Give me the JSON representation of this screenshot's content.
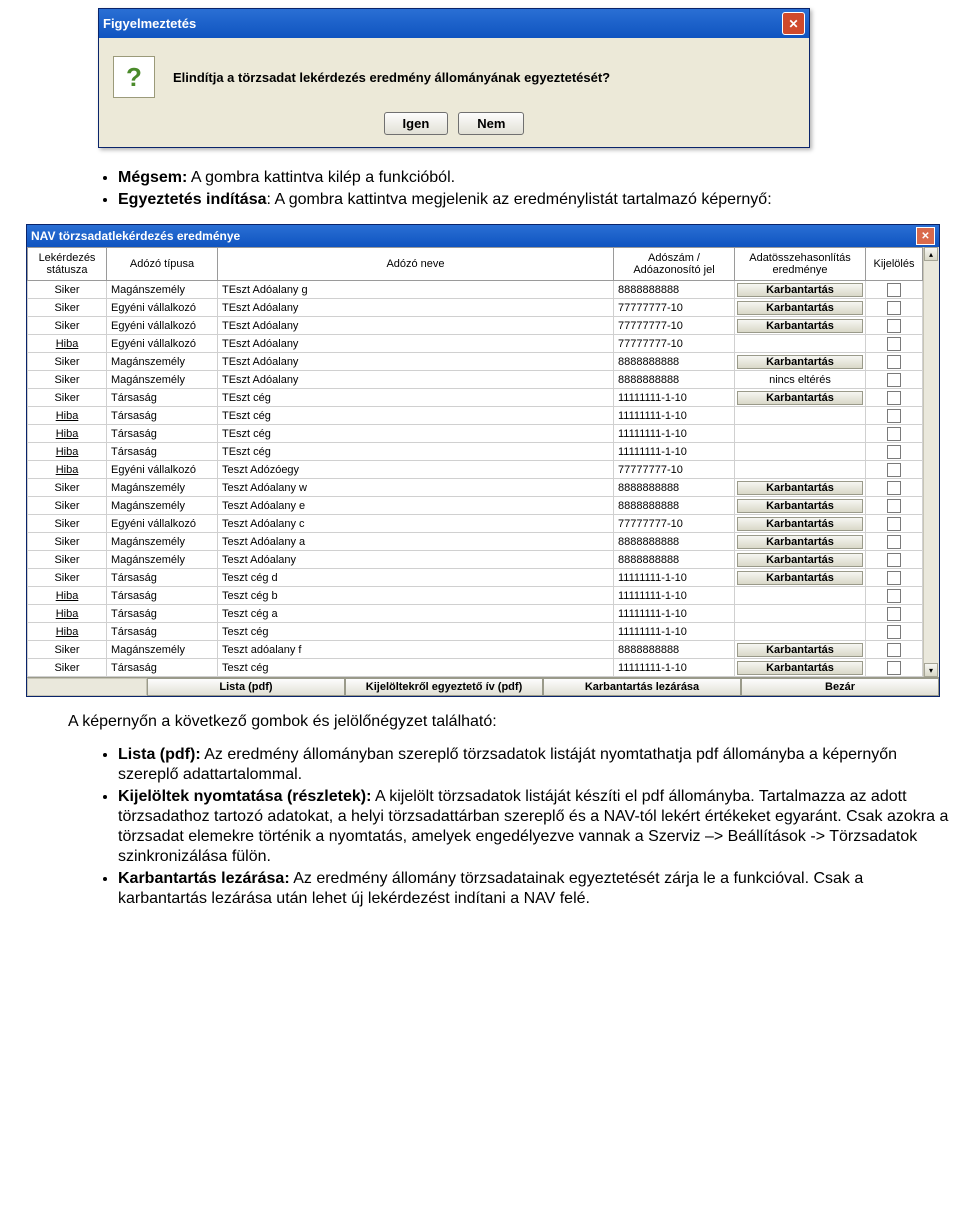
{
  "dialog": {
    "title": "Figyelmeztetés",
    "message": "Elindítja a törzsadat lekérdezés eredmény állományának egyeztetését?",
    "yes": "Igen",
    "no": "Nem"
  },
  "bullets_top": [
    {
      "bold": "Mégsem:",
      "text": " A gombra kattintva kilép a funkcióból."
    },
    {
      "bold": "Egyeztetés indítása",
      "text": ": A gombra kattintva megjelenik az eredménylistát tartalmazó képernyő:"
    }
  ],
  "results": {
    "title": "NAV törzsadatlekérdezés eredménye",
    "headers": {
      "status": "Lekérdezés státusza",
      "type": "Adózó típusa",
      "name": "Adózó neve",
      "taxid": "Adószám / Adóazonosító jel",
      "compare": "Adatösszehasonlítás eredménye",
      "select": "Kijelölés"
    },
    "maint_label": "Karbantartás",
    "no_diff": "nincs eltérés",
    "rows": [
      {
        "s": "Siker",
        "t": "Magánszemély",
        "n": "TEszt Adóalany g",
        "id": "8888888888",
        "r": "maint"
      },
      {
        "s": "Siker",
        "t": "Egyéni vállalkozó",
        "n": "TEszt Adóalany",
        "id": "77777777-10",
        "r": "maint"
      },
      {
        "s": "Siker",
        "t": "Egyéni vállalkozó",
        "n": "TEszt Adóalany",
        "id": "77777777-10",
        "r": "maint"
      },
      {
        "s": "Hiba",
        "t": "Egyéni vállalkozó",
        "n": "TEszt Adóalany",
        "id": "77777777-10",
        "r": ""
      },
      {
        "s": "Siker",
        "t": "Magánszemély",
        "n": "TEszt Adóalany",
        "id": "8888888888",
        "r": "maint"
      },
      {
        "s": "Siker",
        "t": "Magánszemély",
        "n": "TEszt Adóalany",
        "id": "8888888888",
        "r": "nodiff"
      },
      {
        "s": "Siker",
        "t": "Társaság",
        "n": "TEszt cég",
        "id": "11111111-1-10",
        "r": "maint"
      },
      {
        "s": "Hiba",
        "t": "Társaság",
        "n": "TEszt cég",
        "id": "11111111-1-10",
        "r": ""
      },
      {
        "s": "Hiba",
        "t": "Társaság",
        "n": "TEszt cég",
        "id": "11111111-1-10",
        "r": ""
      },
      {
        "s": "Hiba",
        "t": "Társaság",
        "n": "TEszt cég",
        "id": "11111111-1-10",
        "r": ""
      },
      {
        "s": "Hiba",
        "t": "Egyéni vállalkozó",
        "n": "Teszt Adózóegy",
        "id": "77777777-10",
        "r": ""
      },
      {
        "s": "Siker",
        "t": "Magánszemély",
        "n": "Teszt Adóalany w",
        "id": "8888888888",
        "r": "maint"
      },
      {
        "s": "Siker",
        "t": "Magánszemély",
        "n": "Teszt Adóalany e",
        "id": "8888888888",
        "r": "maint"
      },
      {
        "s": "Siker",
        "t": "Egyéni vállalkozó",
        "n": "Teszt Adóalany c",
        "id": "77777777-10",
        "r": "maint"
      },
      {
        "s": "Siker",
        "t": "Magánszemély",
        "n": "Teszt Adóalany a",
        "id": "8888888888",
        "r": "maint"
      },
      {
        "s": "Siker",
        "t": "Magánszemély",
        "n": "Teszt Adóalany",
        "id": "8888888888",
        "r": "maint"
      },
      {
        "s": "Siker",
        "t": "Társaság",
        "n": "Teszt cég d",
        "id": "11111111-1-10",
        "r": "maint"
      },
      {
        "s": "Hiba",
        "t": "Társaság",
        "n": "Teszt cég b",
        "id": "11111111-1-10",
        "r": ""
      },
      {
        "s": "Hiba",
        "t": "Társaság",
        "n": "Teszt cég a",
        "id": "11111111-1-10",
        "r": ""
      },
      {
        "s": "Hiba",
        "t": "Társaság",
        "n": "Teszt cég",
        "id": "11111111-1-10",
        "r": ""
      },
      {
        "s": "Siker",
        "t": "Magánszemély",
        "n": "Teszt adóalany f",
        "id": "8888888888",
        "r": "maint"
      },
      {
        "s": "Siker",
        "t": "Társaság",
        "n": "Teszt cég",
        "id": "11111111-1-10",
        "r": "maint"
      }
    ],
    "bottom_buttons": {
      "lista": "Lista (pdf)",
      "kijelolt": "Kijelöltekről egyeztető ív (pdf)",
      "lezar": "Karbantartás lezárása",
      "bezar": "Bezár"
    }
  },
  "mid_text": "A képernyőn a következő gombok és jelölőnégyzet található:",
  "bullets_bottom": [
    {
      "bold": "Lista (pdf):",
      "text": " Az eredmény állományban szereplő törzsadatok listáját nyomtathatja pdf állományba a képernyőn szereplő adattartalommal."
    },
    {
      "bold": "Kijelöltek nyomtatása (részletek):",
      "text": " A kijelölt törzsadatok listáját készíti el pdf állományba. Tartalmazza az adott törzsadathoz tartozó adatokat, a helyi törzsadattárban szereplő és a NAV-tól lekért értékeket egyaránt. Csak azokra a törzsadat elemekre történik a nyomtatás, amelyek engedélyezve vannak a Szerviz –> Beállítások -> Törzsadatok szinkronizálása fülön."
    },
    {
      "bold": "Karbantartás lezárása:",
      "text": " Az eredmény állomány törzsadatainak egyeztetését zárja le a funkcióval. Csak a karbantartás lezárása után lehet új lekérdezést indítani a NAV felé."
    }
  ]
}
